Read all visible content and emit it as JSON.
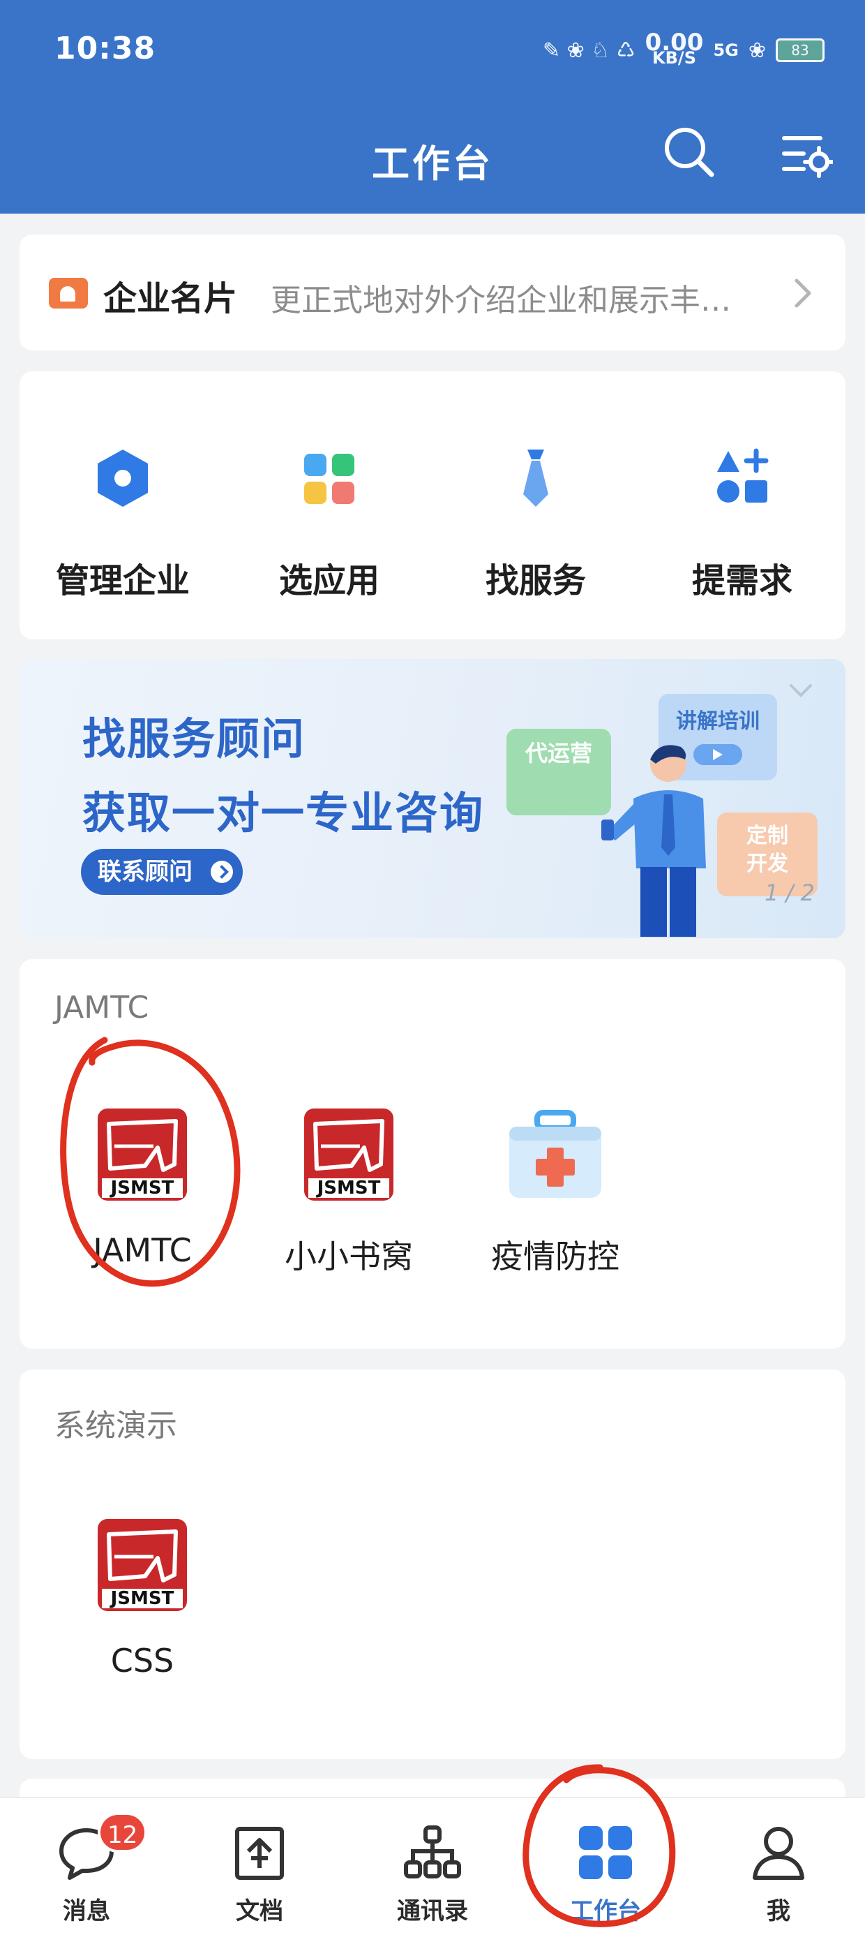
{
  "status_bar": {
    "time": "10:38",
    "speed_value": "0.00",
    "speed_unit": "KB/S",
    "network": "5G",
    "battery": "83"
  },
  "header": {
    "title": "工作台",
    "search_icon": "search-icon",
    "settings_icon": "list-settings-icon",
    "background": "#3a74c8"
  },
  "namecard": {
    "title": "企业名片",
    "description": "更正式地对外介绍企业和展示丰…",
    "icon": "id-card-icon",
    "accent": "#f07a42"
  },
  "shortcuts": [
    {
      "label": "管理企业",
      "icon": "hexagon-icon"
    },
    {
      "label": "选应用",
      "icon": "app-grid-icon"
    },
    {
      "label": "找服务",
      "icon": "necktie-icon"
    },
    {
      "label": "提需求",
      "icon": "shapes-plus-icon"
    }
  ],
  "banner": {
    "line1": "找服务顾问",
    "line2": "获取一对一专业咨询",
    "button": "联系顾问",
    "tag_ops": "代运营",
    "tag_training": "讲解培训",
    "tag_custom_1": "定制",
    "tag_custom_2": "开发",
    "pager": "1 / 2",
    "accent": "#2d66c9"
  },
  "groups": [
    {
      "title": "JAMTC",
      "apps": [
        {
          "label": "JAMTC",
          "icon": "jsmst-logo-icon"
        },
        {
          "label": "小小书窝",
          "icon": "jsmst-logo-icon"
        },
        {
          "label": "疫情防控",
          "icon": "first-aid-kit-icon"
        }
      ]
    },
    {
      "title": "系统演示",
      "apps": [
        {
          "label": "CSS",
          "icon": "jsmst-logo-icon"
        }
      ]
    }
  ],
  "logo_text": "JSMST",
  "bottom_nav": [
    {
      "label": "消息",
      "icon": "chat-bubble-icon",
      "badge": "12"
    },
    {
      "label": "文档",
      "icon": "document-icon"
    },
    {
      "label": "通讯录",
      "icon": "org-chart-icon"
    },
    {
      "label": "工作台",
      "icon": "workbench-grid-icon",
      "active": true
    },
    {
      "label": "我",
      "icon": "person-icon"
    }
  ],
  "colors": {
    "primary": "#3a74c8",
    "badge": "#e8463a",
    "annotation": "#e0301e"
  }
}
